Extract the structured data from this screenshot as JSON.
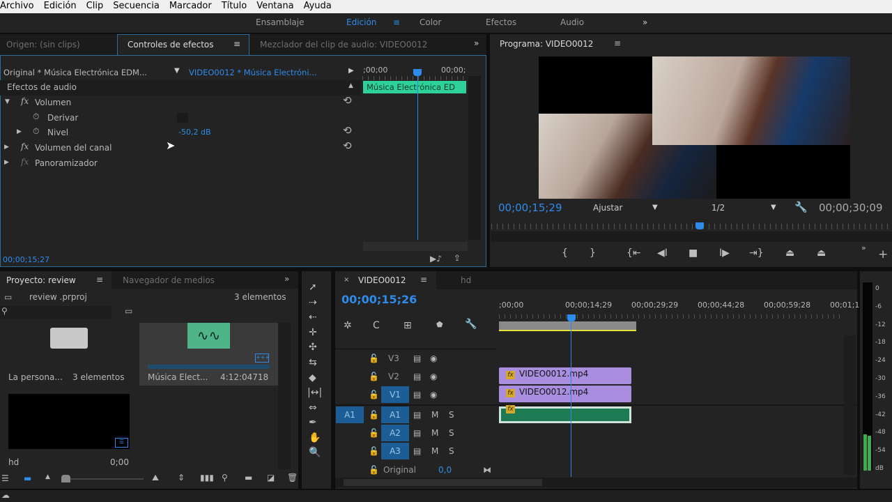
{
  "menu": [
    "Archivo",
    "Edición",
    "Clip",
    "Secuencia",
    "Marcador",
    "Título",
    "Ventana",
    "Ayuda"
  ],
  "workspaces": {
    "items": [
      "Ensamblaje",
      "Edición",
      "Color",
      "Efectos",
      "Audio"
    ],
    "active": "Edición",
    "more": "»"
  },
  "effect_panel": {
    "tabs": [
      "Origen: (sin clips)",
      "Controles de efectos",
      "Mezclador del clip de audio: VIDEO0012"
    ],
    "source": "Original * Música Electrónica EDM...",
    "sequence": "VIDEO0012 * Música Electróni...",
    "ruler_start": ";00;00",
    "ruler_end": "00;00;",
    "clip_label": "Música Electrónica ED",
    "section": "Efectos de audio",
    "rows": [
      {
        "label": "Volumen"
      },
      {
        "label": "Derivar"
      },
      {
        "label": "Nivel",
        "value": "-50,2 dB"
      },
      {
        "label": "Volumen del canal"
      },
      {
        "label": "Panoramizador"
      }
    ],
    "timecode": "00;00;15;27"
  },
  "program": {
    "title": "Programa: VIDEO0012",
    "timecode": "00;00;15;29",
    "fit": "Ajustar",
    "resolution": "1/2",
    "duration": "00;00;30;09",
    "playhead_fraction": 0.52
  },
  "project": {
    "tabs": [
      "Proyecto: review",
      "Navegador de medios"
    ],
    "file": "review .prproj",
    "count": "3 elementos",
    "items": [
      {
        "name": "La persona...",
        "meta": "3 elementos"
      },
      {
        "name": "Música Elect...",
        "meta": "4:12:04718"
      },
      {
        "name": "hd",
        "meta": "0;00"
      }
    ]
  },
  "timeline": {
    "tabs": [
      "VIDEO0012",
      "hd"
    ],
    "timecode": "00;00;15;26",
    "ruler": [
      ";00;00",
      "00;00;14;29",
      "00;00;29;29",
      "00;00;44;28",
      "00;00;59;28",
      "00;01;14"
    ],
    "tracks": {
      "video": [
        "V3",
        "V2",
        "V1"
      ],
      "audio": [
        "A1",
        "A2",
        "A3"
      ],
      "source_patch": "A1",
      "mute": "M",
      "solo": "S"
    },
    "clips": [
      "VIDEO0012.mp4",
      "VIDEO0012.mp4"
    ],
    "master": {
      "label": "Original",
      "value": "0,0"
    }
  },
  "meter": {
    "labels": [
      "0",
      "-6",
      "-12",
      "-18",
      "-24",
      "-30",
      "-36",
      "-42",
      "-48",
      "-54",
      "dB"
    ],
    "level_db": -48
  }
}
